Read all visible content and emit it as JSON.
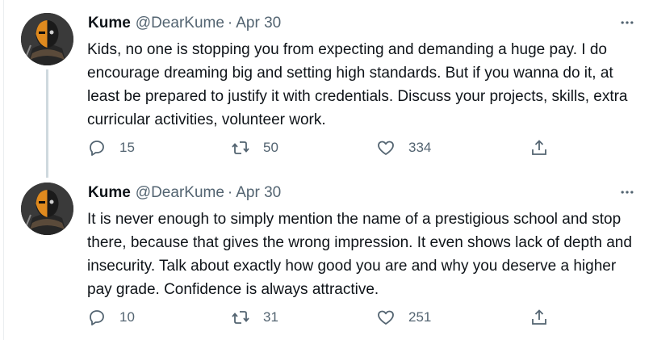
{
  "tweets": [
    {
      "name": "Kume",
      "handle": "@DearKume",
      "dot": "·",
      "date": "Apr 30",
      "text": "Kids, no one is stopping you from expecting and demanding a huge pay. I do encourage dreaming big and setting high standards. But if you wanna do it, at least be prepared to justify it with credentials. Discuss your projects, skills, extra curricular activities, volunteer work.",
      "replies": "15",
      "retweets": "50",
      "likes": "334"
    },
    {
      "name": "Kume",
      "handle": "@DearKume",
      "dot": "·",
      "date": "Apr 30",
      "text": "It is never enough to simply mention the name of a prestigious school and stop there, because that gives the wrong impression. It even shows lack of depth and insecurity. Talk about exactly how good you are and why you deserve a higher pay grade. Confidence is always attractive.",
      "replies": "10",
      "retweets": "31",
      "likes": "251"
    }
  ],
  "icons": {
    "more": "more-options-icon",
    "reply": "reply-icon",
    "retweet": "retweet-icon",
    "like": "like-icon",
    "share": "share-icon"
  },
  "colors": {
    "text": "#0f1419",
    "secondary": "#536471",
    "thread_line": "#cfd9de"
  }
}
